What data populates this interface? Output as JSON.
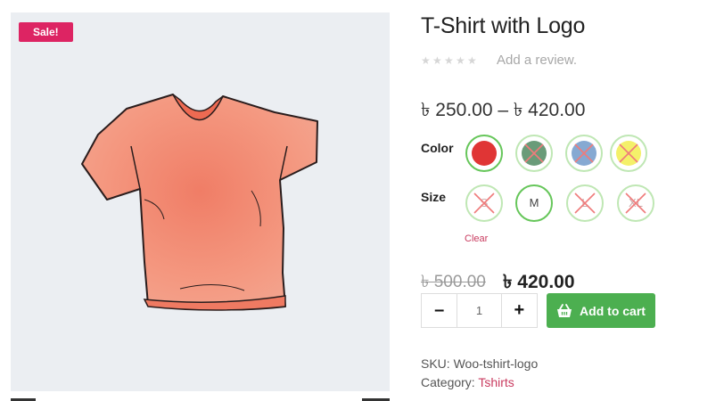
{
  "product": {
    "title": "T-Shirt with Logo",
    "sale_badge": "Sale!",
    "rating_stars": 5,
    "rating_value": 0,
    "review_link": "Add a review.",
    "price_range": "৳ 250.00 – ৳ 420.00",
    "old_price": "৳ 500.00",
    "new_price": "৳ 420.00",
    "image_icon": "tshirt-image"
  },
  "attributes": {
    "color": {
      "label": "Color",
      "options": [
        {
          "value": "red",
          "color": "#e03535",
          "selected": true,
          "available": true
        },
        {
          "value": "green",
          "color": "#6a9b79",
          "selected": false,
          "available": false
        },
        {
          "value": "blue",
          "color": "#86a9d2",
          "selected": false,
          "available": false
        },
        {
          "value": "yellow",
          "color": "#f4f06a",
          "selected": false,
          "available": false
        }
      ]
    },
    "size": {
      "label": "Size",
      "options": [
        {
          "label": "S",
          "selected": false,
          "available": false
        },
        {
          "label": "M",
          "selected": false,
          "available": true
        },
        {
          "label": "L",
          "selected": false,
          "available": false
        },
        {
          "label": "XL",
          "selected": false,
          "available": false
        }
      ]
    },
    "clear_label": "Clear"
  },
  "cart": {
    "minus": "–",
    "quantity": "1",
    "plus": "+",
    "add_label": "Add to cart",
    "icon": "basket-icon",
    "button_color": "#4caf50"
  },
  "meta": {
    "sku_label": "SKU:",
    "sku_value": "Woo-tshirt-logo",
    "category_label": "Category:",
    "category_value": "Tshirts"
  },
  "theme": {
    "accent": "#c93b5f",
    "sale_color": "#dd2463",
    "swatch_selected": "#66c65a",
    "swatch_border": "#bfe7b4"
  }
}
